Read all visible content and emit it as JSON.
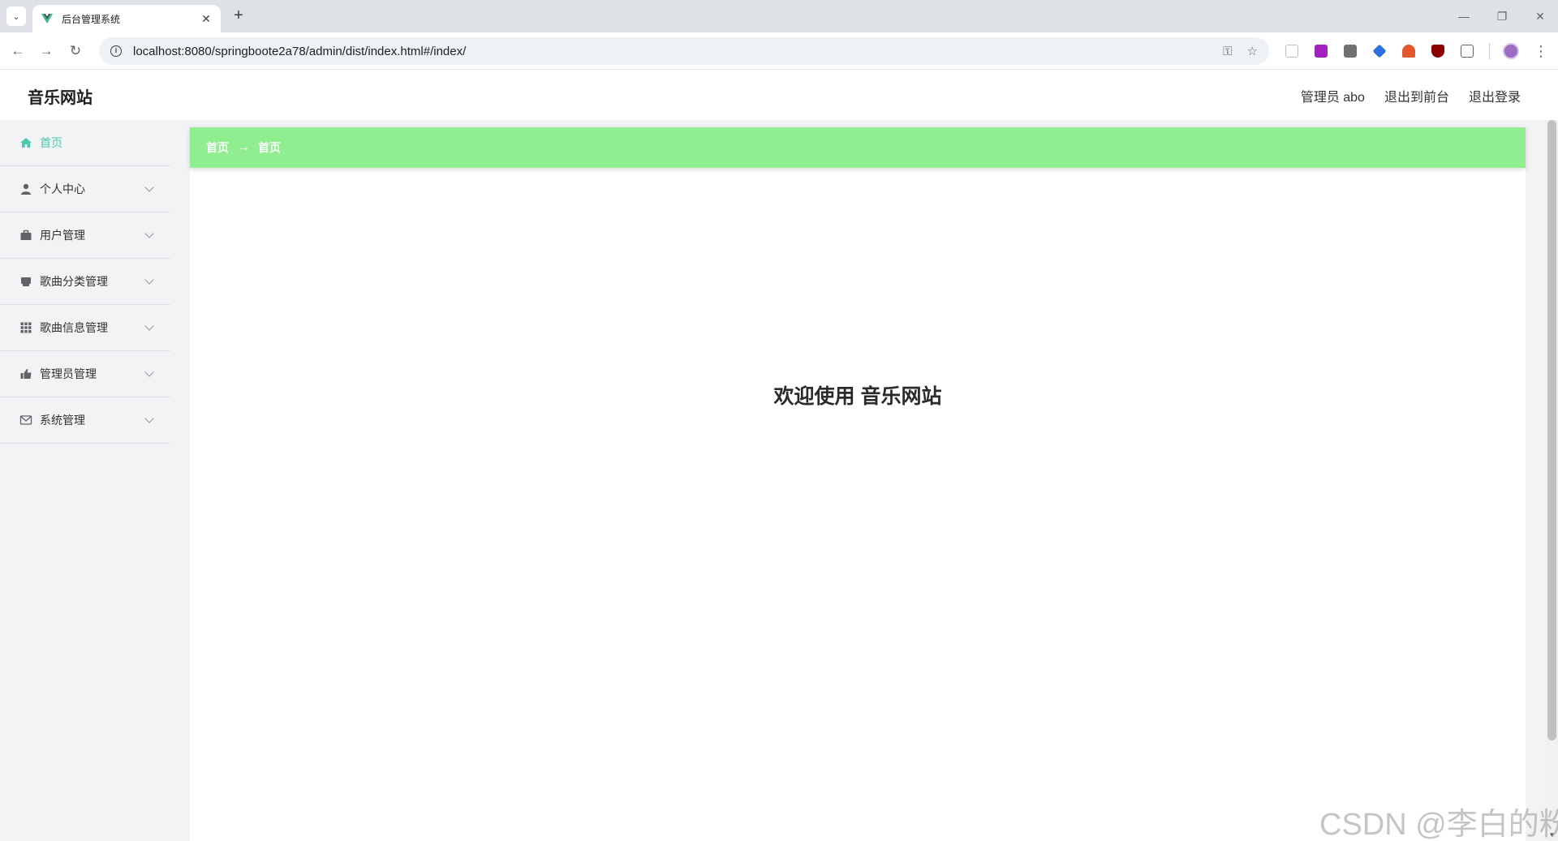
{
  "browser": {
    "tab_title": "后台管理系统",
    "url": "localhost:8080/springboote2a78/admin/dist/index.html#/index/"
  },
  "header": {
    "app_title": "音乐网站",
    "user_label": "管理员 abo",
    "back_to_front": "退出到前台",
    "logout": "退出登录"
  },
  "sidebar": {
    "items": [
      {
        "label": "首页",
        "icon": "home-icon",
        "active": true
      },
      {
        "label": "个人中心",
        "icon": "user-icon"
      },
      {
        "label": "用户管理",
        "icon": "briefcase-icon"
      },
      {
        "label": "歌曲分类管理",
        "icon": "folder-icon"
      },
      {
        "label": "歌曲信息管理",
        "icon": "grid-icon"
      },
      {
        "label": "管理员管理",
        "icon": "thumbs-up-icon"
      },
      {
        "label": "系统管理",
        "icon": "mail-icon"
      }
    ]
  },
  "breadcrumb": {
    "first": "首页",
    "separator": "→",
    "second": "首页"
  },
  "main": {
    "welcome": "欢迎使用 音乐网站"
  },
  "watermark": "CSDN @李白的粉",
  "colors": {
    "accent": "#48c9b0",
    "breadcrumb_bg": "#90ee90"
  }
}
